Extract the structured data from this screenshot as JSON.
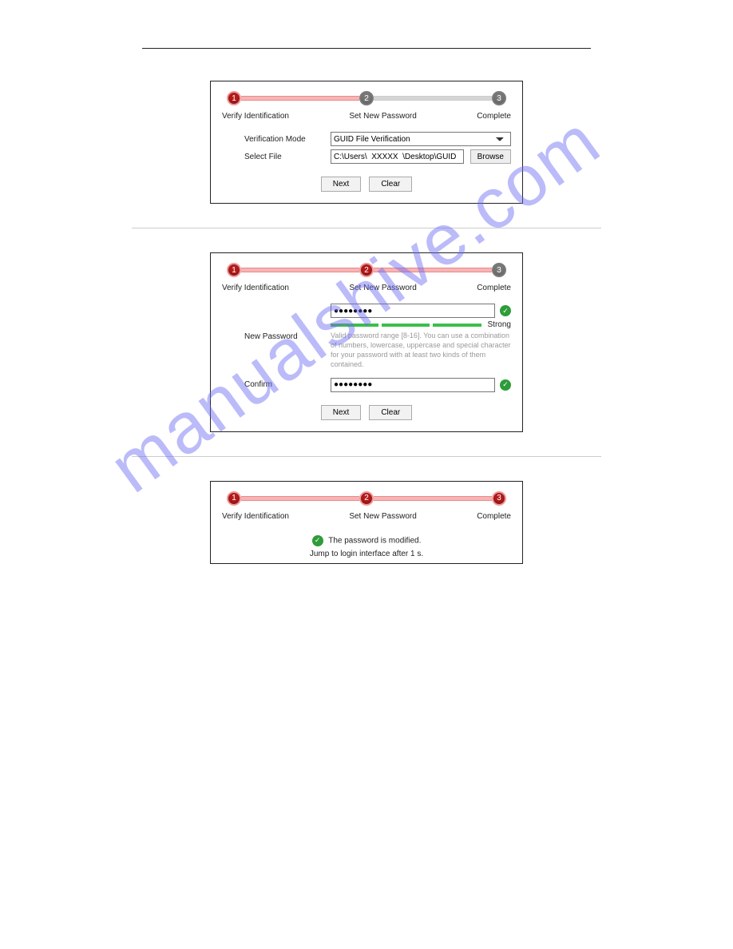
{
  "watermark": "manualshive.com",
  "stepLabels": {
    "step1": "Verify Identification",
    "step2": "Set New Password",
    "step3": "Complete"
  },
  "stepNumbers": {
    "n1": "1",
    "n2": "2",
    "n3": "3"
  },
  "dialog1": {
    "verificationModeLabel": "Verification Mode",
    "verificationModeValue": "GUID File Verification",
    "selectFileLabel": "Select File",
    "selectFileValue": "C:\\Users\\  XXXXX  \\Desktop\\GUID",
    "browse": "Browse",
    "next": "Next",
    "clear": "Clear"
  },
  "dialog2": {
    "newPasswordLabel": "New Password",
    "newPasswordValue": "●●●●●●●●",
    "confirmLabel": "Confirm",
    "confirmValue": "●●●●●●●●",
    "strength": "Strong",
    "hint": "Valid password range [8-16]. You can use a combination of numbers, lowercase, uppercase and special character for your password with at least two kinds of them contained.",
    "next": "Next",
    "clear": "Clear"
  },
  "dialog3": {
    "successMsg": "The password is modified.",
    "jumpMsg": "Jump to login interface after 1 s."
  }
}
